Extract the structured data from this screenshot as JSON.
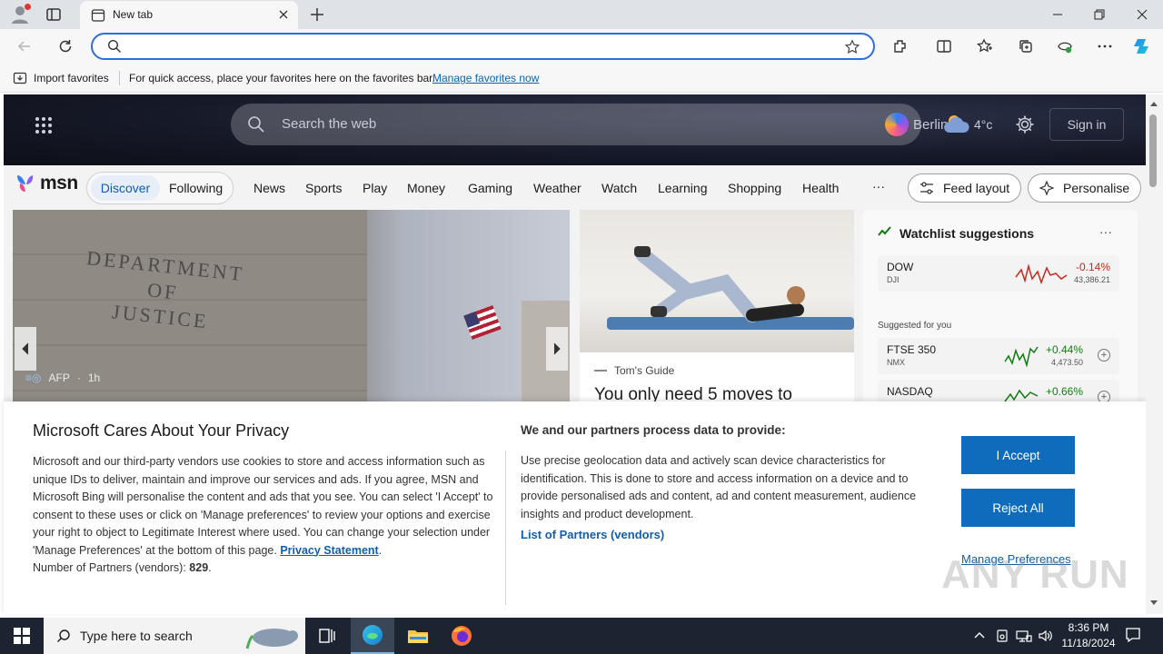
{
  "browser": {
    "tab_title": "New tab",
    "favorites_bar": {
      "import_label": "Import favorites",
      "hint": "For quick access, place your favorites here on the favorites bar.",
      "manage_link": "Manage favorites now"
    }
  },
  "msn": {
    "search_placeholder": "Search the web",
    "city": "Berlin",
    "temperature": "4°c",
    "sign_in": "Sign in",
    "logo_text": "msn",
    "tabs": {
      "discover": "Discover",
      "following": "Following"
    },
    "nav": [
      "News",
      "Sports",
      "Play",
      "Money",
      "Gaming",
      "Weather",
      "Watch",
      "Learning",
      "Shopping",
      "Health"
    ],
    "more": "···",
    "feed_layout": "Feed layout",
    "personalise": "Personalise",
    "card1": {
      "source": "AFP",
      "age": "1h",
      "engraving": "DEPARTMENT\nOF\nJUSTICE"
    },
    "card2": {
      "source": "Tom's Guide",
      "headline": "You only need 5 moves to"
    },
    "watchlist": {
      "title": "Watchlist suggestions",
      "more": "···",
      "suggested_label": "Suggested for you",
      "stocks": [
        {
          "symbol": "DOW",
          "sub": "DJI",
          "pct": "-0.14%",
          "value": "43,386.21",
          "color": "#c42b1c"
        },
        {
          "symbol": "FTSE 350",
          "sub": "NMX",
          "pct": "+0.44%",
          "value": "4,473.50",
          "color": "#107c10"
        },
        {
          "symbol": "NASDAQ",
          "sub": "",
          "pct": "+0.66%",
          "value": "",
          "color": "#107c10"
        }
      ]
    }
  },
  "privacy": {
    "title": "Microsoft Cares About Your Privacy",
    "body": "Microsoft and our third-party vendors use cookies to store and access information such as unique IDs to deliver, maintain and improve our services and ads. If you agree, MSN and Microsoft Bing will personalise the content and ads that you see. You can select 'I Accept' to consent to these uses or click on 'Manage preferences' to review your options and exercise your right to object to Legitimate Interest where used.  You can change your selection under 'Manage Preferences' at the bottom of this page.",
    "privacy_link": "Privacy Statement",
    "partners_count_label": "Number of Partners (vendors):",
    "partners_count": "829",
    "right_title": "We and our partners process data to provide:",
    "right_body": "Use precise geolocation data and actively scan device characteristics for identification. This is done to store and access information on a device and to provide personalised ads and content, ad and content measurement, audience insights and product development.",
    "partners_link": "List of Partners (vendors)",
    "accept": "I Accept",
    "reject": "Reject All",
    "manage": "Manage Preferences"
  },
  "taskbar": {
    "search_placeholder": "Type here to search",
    "time": "8:36 PM",
    "date": "11/18/2024"
  },
  "watermark": "ANY RUN",
  "colors": {
    "accent": "#0f6cbd",
    "omnibox_border": "#2a6fdb"
  }
}
